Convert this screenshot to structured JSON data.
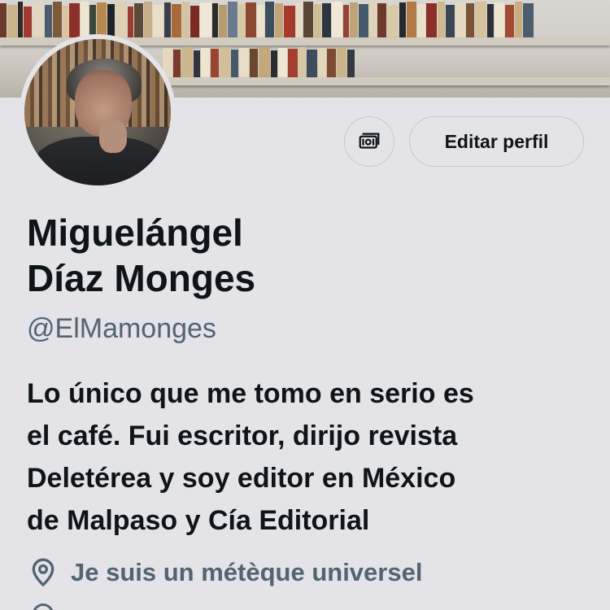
{
  "profile": {
    "name_line1": "Miguelángel",
    "name_line2": "Díaz Monges",
    "handle": "@ElMamonges",
    "bio_lines": [
      "Lo único que me tomo en serio es",
      "el café. Fui escritor, dirijo revista",
      "Deletérea y soy editor en México",
      "de Malpaso y Cía Editorial"
    ],
    "location": "Je suis un métèque universel"
  },
  "actions": {
    "edit_label": "Editar perfil",
    "money_icon": "money-icon"
  },
  "icons": {
    "location": "location-pin-icon"
  },
  "colors": {
    "background": "#e3e3e8",
    "text_primary": "#0f1419",
    "text_secondary": "#536471",
    "border": "#c3c9cf"
  }
}
